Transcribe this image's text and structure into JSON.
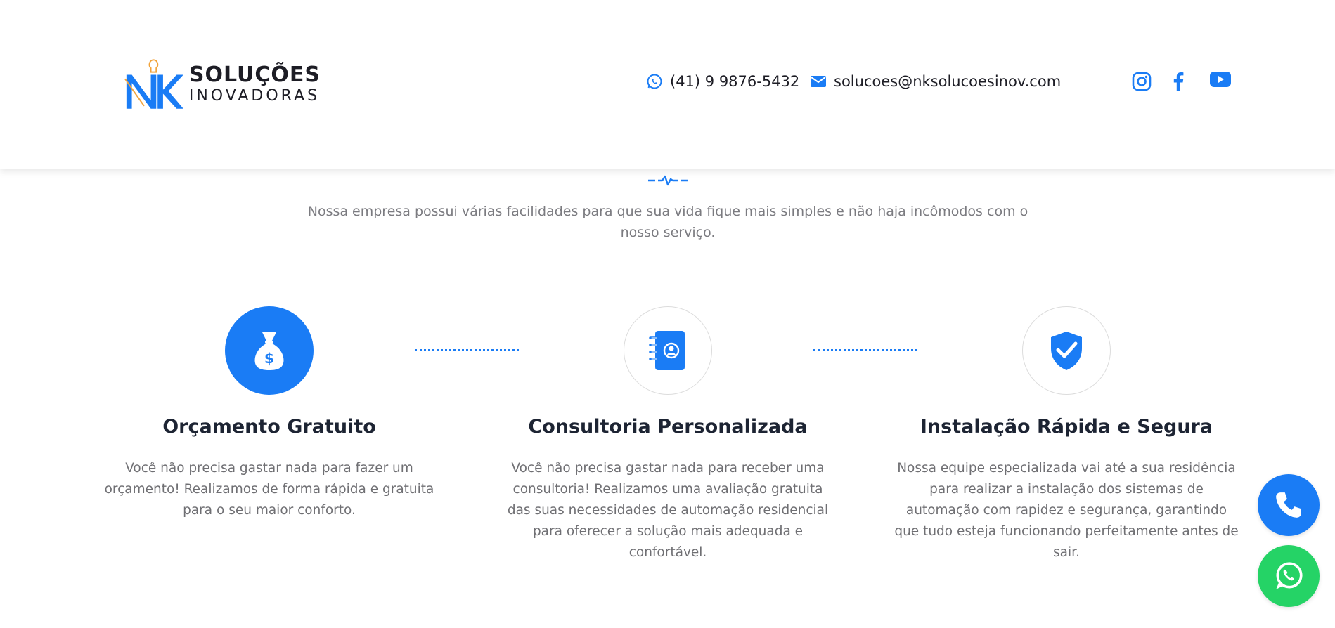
{
  "header": {
    "logo": {
      "line1": "SOLUÇÕES",
      "line2": "INOVADORAS",
      "mark": "NK"
    },
    "phone": {
      "icon": "whatsapp-icon",
      "text": "(41) 9 9876-5432"
    },
    "email": {
      "icon": "envelope-icon",
      "text": "solucoes@nksolucoesinov.com"
    },
    "social": [
      {
        "icon": "instagram-icon"
      },
      {
        "icon": "facebook-icon"
      },
      {
        "icon": "youtube-icon"
      }
    ]
  },
  "intro": {
    "text": "Nossa empresa possui várias facilidades para que sua vida fique mais simples e não haja incômodos com o nosso serviço."
  },
  "steps": [
    {
      "icon": "money-bag-icon",
      "title": "Orçamento Gratuito",
      "description": "Você não precisa gastar nada para fazer um orçamento! Realizamos de forma rápida e gratuita para o seu maior conforto."
    },
    {
      "icon": "contact-book-icon",
      "title": "Consultoria Personalizada",
      "description": "Você não precisa gastar nada para receber uma consultoria! Realizamos uma avaliação gratuita das suas necessidades de automação residencial para oferecer a solução mais adequada e confortável."
    },
    {
      "icon": "shield-check-icon",
      "title": "Instalação Rápida e Segura",
      "description": "Nossa equipe especializada vai até a sua residência para realizar a instalação dos sistemas de automação com rapidez e segurança, garantindo que tudo esteja funcionando perfeitamente antes de sair."
    }
  ],
  "floating": {
    "phone_icon": "phone-icon",
    "whatsapp_icon": "whatsapp-icon"
  },
  "colors": {
    "accent": "#1a7cf5",
    "heading": "#1d2433",
    "text": "#6f6f73",
    "whatsapp": "#25d366",
    "logo_gold": "#f2a33a"
  }
}
